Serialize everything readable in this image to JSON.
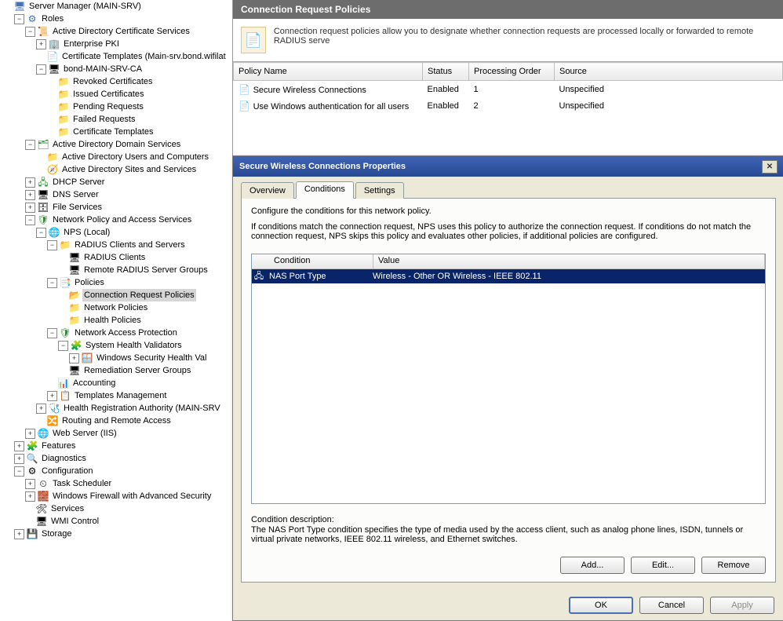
{
  "tree_root_label": "Server Manager (MAIN-SRV)",
  "tree": {
    "roles": "Roles",
    "adcs": "Active Directory Certificate Services",
    "enterprise_pki": "Enterprise PKI",
    "cert_templates_main": "Certificate Templates (Main-srv.bond.wifilat",
    "bond_ca": "bond-MAIN-SRV-CA",
    "revoked": "Revoked Certificates",
    "issued": "Issued Certificates",
    "pending": "Pending Requests",
    "failed": "Failed Requests",
    "cert_templates": "Certificate Templates",
    "adds": "Active Directory Domain Services",
    "ad_users": "Active Directory Users and Computers",
    "ad_sites": "Active Directory Sites and Services",
    "dhcp": "DHCP Server",
    "dns": "DNS Server",
    "file": "File Services",
    "npas": "Network Policy and Access Services",
    "nps_local": "NPS (Local)",
    "radius_cs": "RADIUS Clients and Servers",
    "radius_clients": "RADIUS Clients",
    "remote_radius": "Remote RADIUS Server Groups",
    "policies": "Policies",
    "crp": "Connection Request Policies",
    "np": "Network Policies",
    "hp": "Health Policies",
    "nap": "Network Access Protection",
    "shv": "System Health Validators",
    "wshv": "Windows Security Health Val",
    "rsg": "Remediation Server Groups",
    "accounting": "Accounting",
    "templates_mgmt": "Templates Management",
    "hra": "Health Registration Authority (MAIN-SRV",
    "rras": "Routing and Remote Access",
    "iis": "Web Server (IIS)",
    "features": "Features",
    "diagnostics": "Diagnostics",
    "configuration": "Configuration",
    "task_sched": "Task Scheduler",
    "wfas": "Windows Firewall with Advanced Security",
    "services": "Services",
    "wmi": "WMI Control",
    "storage": "Storage"
  },
  "rightpane": {
    "title": "Connection Request Policies",
    "info": "Connection request policies allow you to designate whether connection requests are processed locally or forwarded to remote RADIUS serve",
    "columns": {
      "c1": "Policy Name",
      "c2": "Status",
      "c3": "Processing Order",
      "c4": "Source"
    },
    "rows": [
      {
        "name": "Secure Wireless Connections",
        "status": "Enabled",
        "order": "1",
        "source": "Unspecified"
      },
      {
        "name": "Use Windows authentication for all users",
        "status": "Enabled",
        "order": "2",
        "source": "Unspecified"
      }
    ]
  },
  "dialog": {
    "title": "Secure Wireless Connections Properties",
    "tabs": {
      "overview": "Overview",
      "conditions": "Conditions",
      "settings": "Settings"
    },
    "intro": "Configure the conditions for this network policy.",
    "explain": "If conditions match the connection request, NPS uses this policy to authorize the connection request. If conditions do not match the connection request, NPS skips this policy and evaluates other policies, if additional policies are configured.",
    "cond_headers": {
      "condition": "Condition",
      "value": "Value"
    },
    "cond_row": {
      "condition": "NAS Port Type",
      "value": "Wireless - Other OR Wireless - IEEE 802.11"
    },
    "desc_head": "Condition description:",
    "desc_body": "The NAS Port Type condition specifies the type of media used by the access client, such as analog phone lines, ISDN, tunnels or virtual private networks, IEEE 802.11 wireless, and Ethernet switches.",
    "buttons": {
      "add": "Add...",
      "edit": "Edit...",
      "remove": "Remove",
      "ok": "OK",
      "cancel": "Cancel",
      "apply": "Apply"
    }
  }
}
